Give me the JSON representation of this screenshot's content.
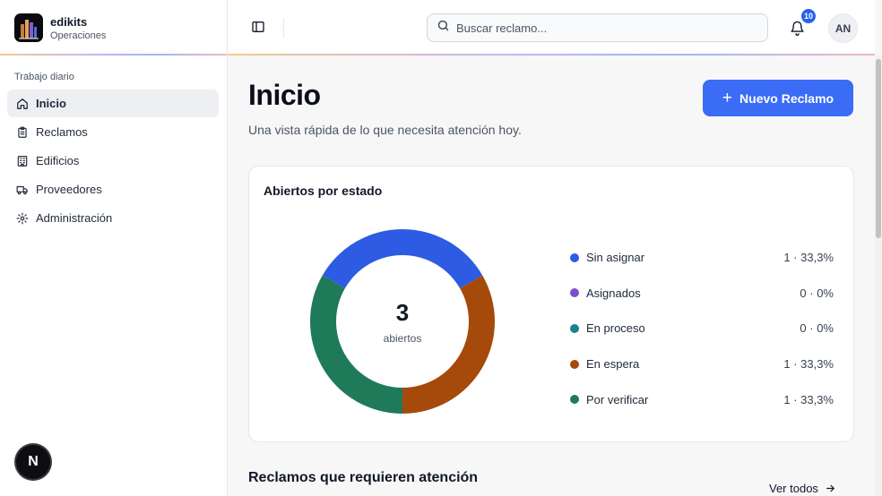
{
  "brand": {
    "name": "edikits",
    "subtitle": "Operaciones"
  },
  "sidebar": {
    "section_label": "Trabajo diario",
    "items": [
      {
        "label": "Inicio",
        "icon": "home-icon",
        "active": true
      },
      {
        "label": "Reclamos",
        "icon": "clipboard-icon",
        "active": false
      },
      {
        "label": "Edificios",
        "icon": "building-icon",
        "active": false
      },
      {
        "label": "Proveedores",
        "icon": "truck-icon",
        "active": false
      },
      {
        "label": "Administración",
        "icon": "gear-icon",
        "active": false
      }
    ],
    "fab_label": "N"
  },
  "header": {
    "search_placeholder": "Buscar reclamo...",
    "notification_count": "10",
    "avatar_initials": "AN"
  },
  "main": {
    "title": "Inicio",
    "subtitle": "Una vista rápida de lo que necesita atención hoy.",
    "new_button_label": "Nuevo Reclamo",
    "status_card": {
      "title": "Abiertos por estado",
      "center_value": "3",
      "center_label": "abiertos"
    },
    "attention_section_title": "Reclamos que requieren atención",
    "see_all_label": "Ver todos"
  },
  "chart_data": {
    "type": "pie",
    "categories": [
      "Sin asignar",
      "Asignados",
      "En proceso",
      "En espera",
      "Por verificar"
    ],
    "values": [
      1,
      0,
      0,
      1,
      1
    ],
    "display": [
      "1 · 33,3%",
      "0 · 0%",
      "0 · 0%",
      "1 · 33,3%",
      "1 · 33,3%"
    ],
    "colors": [
      "#2d5be3",
      "#7c4dcc",
      "#1a7f8e",
      "#a54a0a",
      "#1f7a5a"
    ],
    "title": "Abiertos por estado",
    "legend": "right"
  }
}
